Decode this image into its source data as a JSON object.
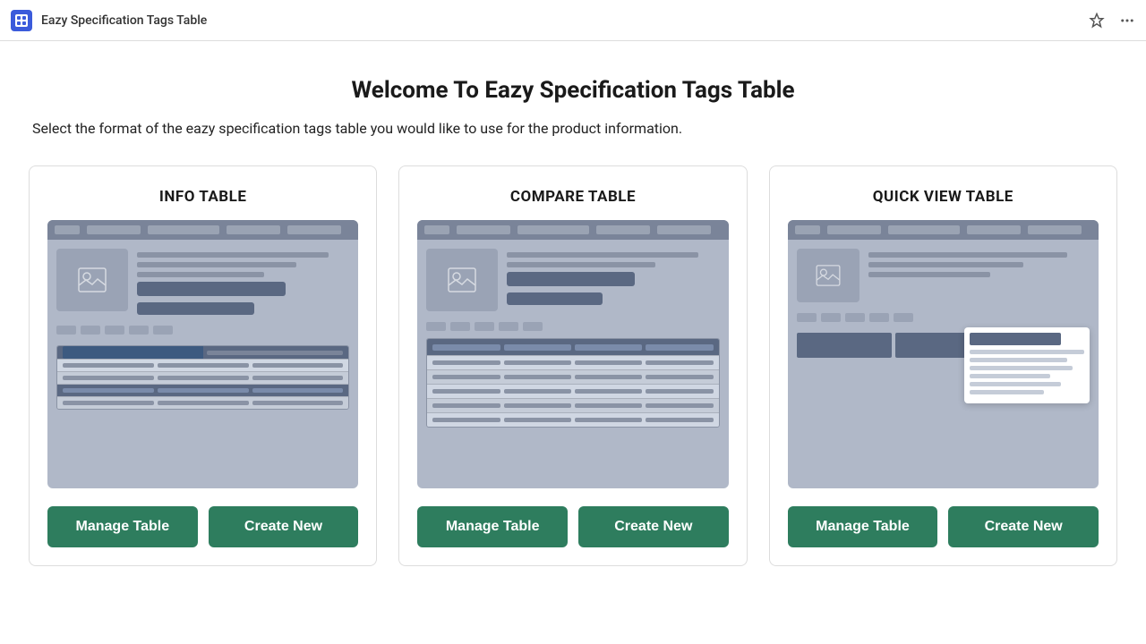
{
  "topbar": {
    "title": "Eazy Specification Tags Table",
    "pin_icon": "pin-icon",
    "more_icon": "more-icon"
  },
  "page": {
    "title": "Welcome To Eazy Specification Tags Table",
    "subtitle": "Select the format of the eazy specification tags table you would like to use for the product information."
  },
  "cards": [
    {
      "id": "info-table",
      "title": "INFO TABLE",
      "manage_label": "Manage Table",
      "create_label": "Create New"
    },
    {
      "id": "compare-table",
      "title": "COMPARE TABLE",
      "manage_label": "Manage Table",
      "create_label": "Create New"
    },
    {
      "id": "quick-view-table",
      "title": "QUICK VIEW TABLE",
      "manage_label": "Manage Table",
      "create_label": "Create New"
    }
  ]
}
